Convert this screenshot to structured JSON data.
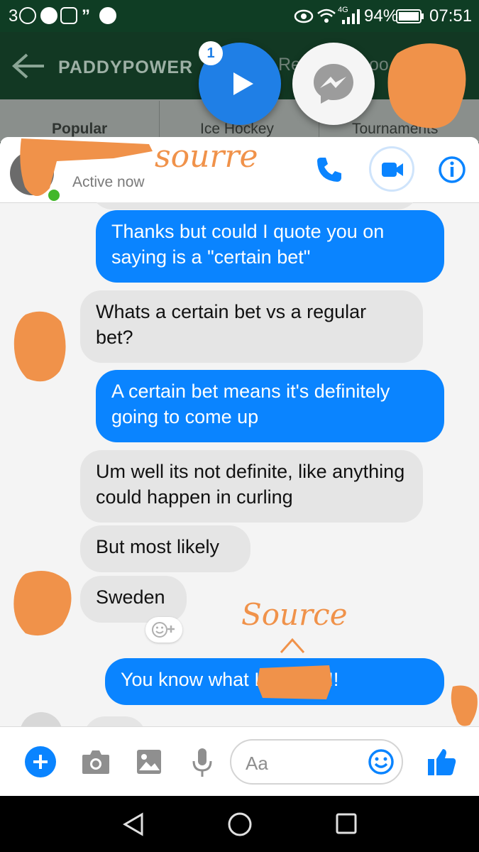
{
  "status_bar": {
    "notification_count": "3",
    "network": "4G",
    "battery": "94%",
    "time": "07:51"
  },
  "background_app": {
    "brand": "PADDYPOWER",
    "partial_top_text_1": "Reg",
    "partial_top_text_2": "oo",
    "tabs": [
      "Popular",
      "Ice Hockey",
      "Tournaments"
    ]
  },
  "chat_heads": {
    "badge_count": "1"
  },
  "chat_header": {
    "annotation": "sourre",
    "active_status": "Active now"
  },
  "messages": [
    {
      "direction": "out",
      "text": "Thanks but could I quote you on saying is a \"certain bet\""
    },
    {
      "direction": "in",
      "text": "Whats a certain bet vs a regular bet?"
    },
    {
      "direction": "out",
      "text": "A certain bet means it's definitely going to come up"
    },
    {
      "direction": "in",
      "text": "Um well its not definite, like anything could happen in curling"
    },
    {
      "direction": "in",
      "text": "But most likely"
    },
    {
      "direction": "in",
      "text": "Sweden"
    },
    {
      "direction": "out",
      "text": "You know what I'll take it!!"
    }
  ],
  "annotations": {
    "handwritten": "Source"
  },
  "composer": {
    "placeholder": "Aa"
  },
  "colors": {
    "messenger_blue": "#0a84ff",
    "incoming_bubble": "#e5e5e5",
    "scribble_orange": "#f0924a"
  }
}
